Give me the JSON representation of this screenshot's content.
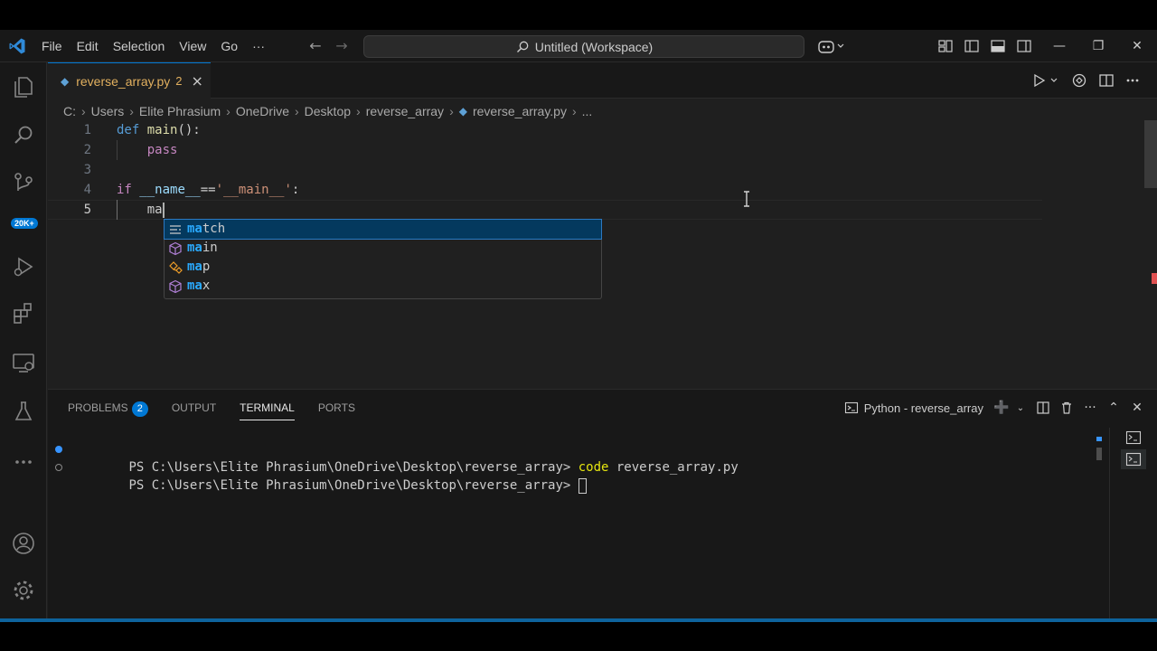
{
  "titlebar": {
    "menu": [
      "File",
      "Edit",
      "Selection",
      "View",
      "Go",
      "···"
    ],
    "command_center": "Untitled (Workspace)",
    "icons": [
      "vscode-logo-icon",
      "back-arrow-icon",
      "forward-arrow-icon",
      "search-icon",
      "copilot-icon",
      "customize-layout-icon",
      "toggle-sidebar-icon",
      "toggle-panel-icon",
      "toggle-secondary-sidebar-icon",
      "minimize-icon",
      "restore-icon",
      "close-icon"
    ]
  },
  "activitybar": {
    "items": [
      "explorer-icon",
      "search-icon",
      "source-control-icon",
      "run-debug-icon",
      "extensions-icon",
      "remote-explorer-icon",
      "testing-icon",
      "more-icon",
      "accounts-icon",
      "manage-icon"
    ],
    "source_control_badge": "20K+"
  },
  "tab": {
    "name": "reverse_array.py",
    "problems": "2",
    "close": "×"
  },
  "breadcrumb": [
    "C:",
    "Users",
    "Elite Phrasium",
    "OneDrive",
    "Desktop",
    "reverse_array",
    "reverse_array.py",
    "..."
  ],
  "code": {
    "line_numbers": [
      "1",
      "2",
      "3",
      "4",
      "5"
    ],
    "l1_def": "def",
    "l1_fn": "main",
    "l1_rest": "():",
    "l2_pass": "pass",
    "l4_if": "if",
    "l4_name": "__name__",
    "l4_eq": "==",
    "l4_str": "'__main__'",
    "l4_colon": ":",
    "l5_typed": "ma"
  },
  "suggestions": [
    {
      "prefix": "ma",
      "rest": "tch",
      "icon": "keyword-icon",
      "selected": true
    },
    {
      "prefix": "ma",
      "rest": "in",
      "icon": "module-icon",
      "selected": false
    },
    {
      "prefix": "ma",
      "rest": "p",
      "icon": "class-icon",
      "selected": false
    },
    {
      "prefix": "ma",
      "rest": "x",
      "icon": "module-icon",
      "selected": false
    }
  ],
  "panel": {
    "tabs": [
      "PROBLEMS",
      "OUTPUT",
      "TERMINAL",
      "PORTS"
    ],
    "problems_count": "2",
    "active_tab": "TERMINAL",
    "terminal_name": "Python - reverse_array",
    "lines": [
      {
        "prompt": "PS C:\\Users\\Elite Phrasium\\OneDrive\\Desktop\\reverse_array> ",
        "cmd": "code",
        "args": " reverse_array.py"
      },
      {
        "prompt": "PS C:\\Users\\Elite Phrasium\\OneDrive\\Desktop\\reverse_array> ",
        "cmd": "",
        "args": ""
      }
    ]
  },
  "colors": {
    "accent": "#0078d4",
    "tab_modified": "#e2b05f",
    "suggest_highlight": "#2aaaff"
  }
}
